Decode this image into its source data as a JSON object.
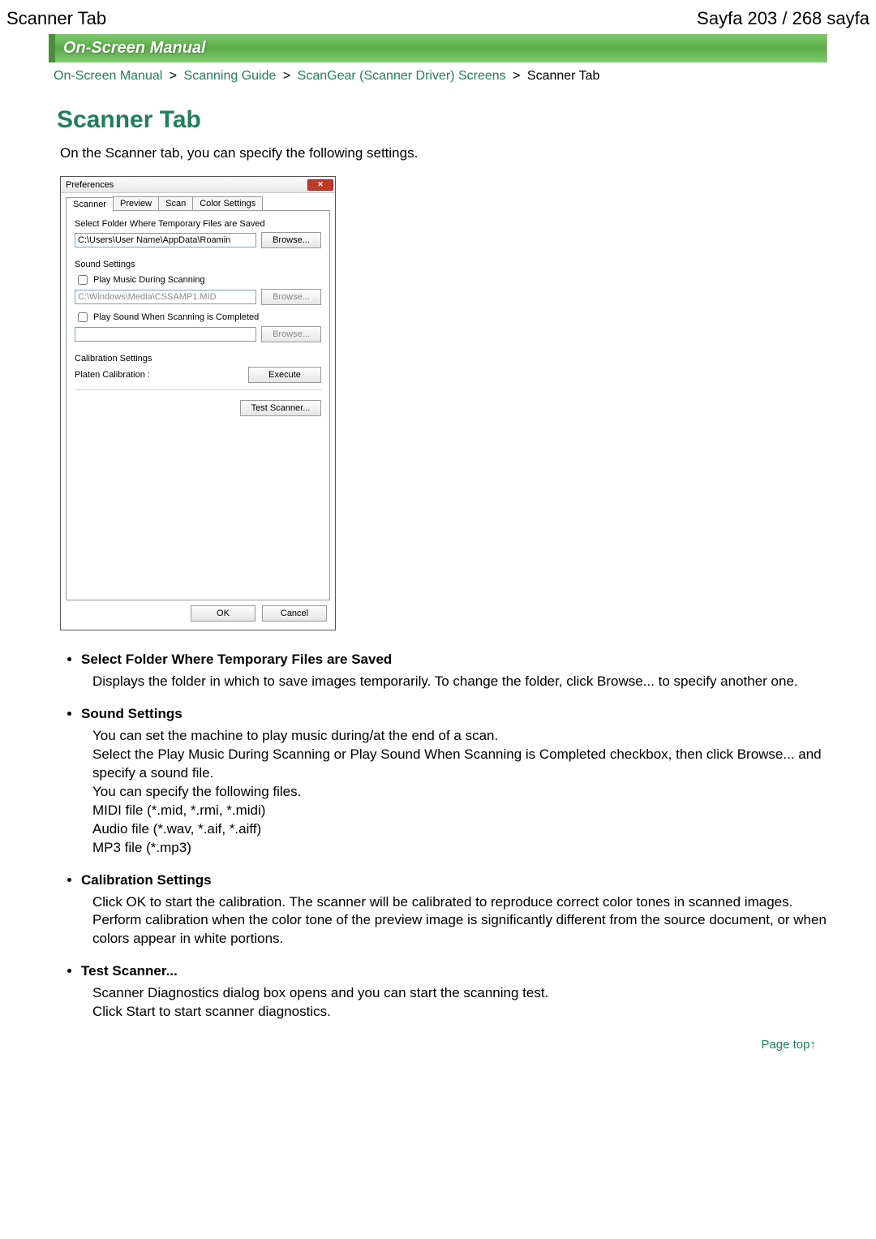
{
  "header": {
    "left": "Scanner Tab",
    "right": "Sayfa 203 / 268 sayfa"
  },
  "greenbar": "On-Screen Manual",
  "breadcrumb": {
    "a1": "On-Screen Manual",
    "a2": "Scanning Guide",
    "a3": "ScanGear (Scanner Driver) Screens",
    "current": "Scanner Tab"
  },
  "title": "Scanner Tab",
  "intro": "On the Scanner tab, you can specify the following settings.",
  "dialog": {
    "title": "Preferences",
    "tabs": [
      "Scanner",
      "Preview",
      "Scan",
      "Color Settings"
    ],
    "section1_label": "Select Folder Where Temporary Files are Saved",
    "folder_value": "C:\\Users\\User Name\\AppData\\Roamin",
    "browse": "Browse...",
    "sound_label": "Sound Settings",
    "chk1": "Play Music During Scanning",
    "sound1_value": "C:\\Windows\\Media\\CSSAMP1.MID",
    "chk2": "Play Sound When Scanning is Completed",
    "calib_label": "Calibration Settings",
    "platen": "Platen Calibration :",
    "execute": "Execute",
    "test": "Test Scanner...",
    "ok": "OK",
    "cancel": "Cancel"
  },
  "bullets": [
    {
      "title": "Select Folder Where Temporary Files are Saved",
      "body": "Displays the folder in which to save images temporarily. To change the folder, click Browse... to specify another one."
    },
    {
      "title": "Sound Settings",
      "body": "You can set the machine to play music during/at the end of a scan.\nSelect the Play Music During Scanning or Play Sound When Scanning is Completed checkbox, then click Browse... and specify a sound file.\nYou can specify the following files.\nMIDI file (*.mid, *.rmi, *.midi)\nAudio file (*.wav, *.aif, *.aiff)\nMP3 file (*.mp3)"
    },
    {
      "title": "Calibration Settings",
      "body": "Click OK to start the calibration. The scanner will be calibrated to reproduce correct color tones in scanned images.\nPerform calibration when the color tone of the preview image is significantly different from the source document, or when colors appear in white portions."
    },
    {
      "title": "Test Scanner...",
      "body": "Scanner Diagnostics dialog box opens and you can start the scanning test.\nClick Start to start scanner diagnostics."
    }
  ],
  "pagetop": "Page top"
}
